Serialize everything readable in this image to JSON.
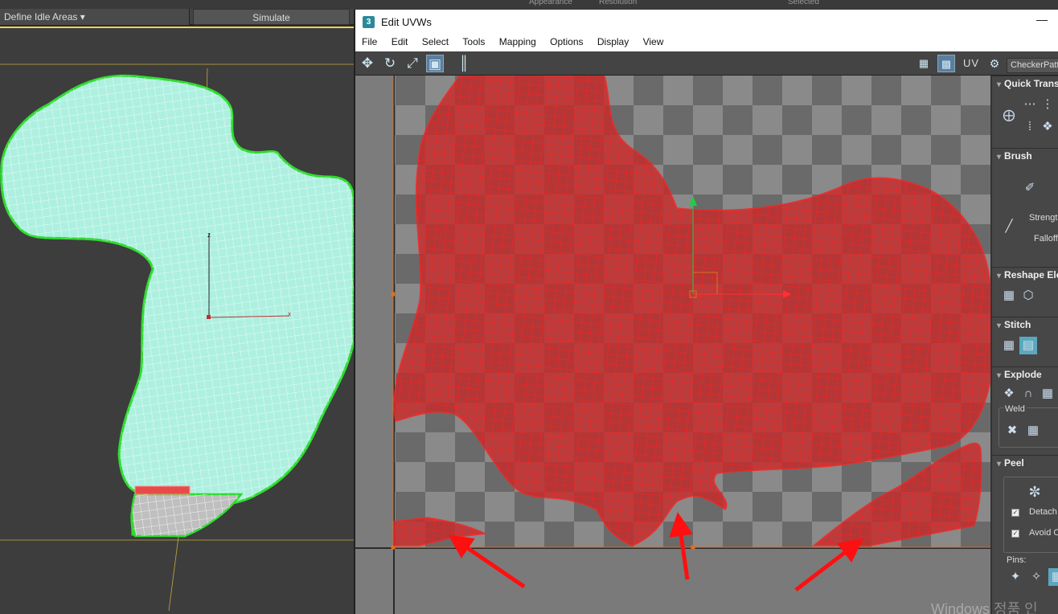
{
  "topbar": {
    "appearance": "Appearance",
    "resolution": "Resolution",
    "selected": "Selected"
  },
  "left_toolbar": {
    "idle_dropdown": "Define Idle Areas",
    "simulate_label": "Simulate"
  },
  "viewport": {
    "axis_z": "z",
    "axis_x": "x"
  },
  "uvw": {
    "app_icon": "3",
    "title": "Edit UVWs",
    "minimize": "—",
    "menu": [
      "File",
      "Edit",
      "Select",
      "Tools",
      "Mapping",
      "Options",
      "Display",
      "View"
    ],
    "toolbar": {
      "move_icon": "✥",
      "rotate_icon": "↻",
      "scale_icon": "⤢",
      "freeform_icon": "▣",
      "mirror_icon": "║",
      "uv_label": "UV",
      "checker_label": "CheckerPatt..."
    }
  },
  "rollouts": {
    "quick_transform": "Quick Transform",
    "brush": "Brush",
    "strength": "Strength",
    "falloff": "Falloff",
    "reshape": "Reshape Elements",
    "stitch": "Stitch",
    "explode": "Explode",
    "weld": "Weld",
    "peel": "Peel",
    "detach": "Detach",
    "avoid": "Avoid Overlap",
    "pins": "Pins:"
  },
  "watermark": "Windows 정품 인",
  "colors": {
    "uv_fill": "#c62b2b",
    "uv_line": "#ff2020",
    "mesh_fill": "#aef0e0",
    "mesh_border": "#2edc2e",
    "arrow": "#ff1010",
    "grid_yellow": "#e8c53a"
  }
}
